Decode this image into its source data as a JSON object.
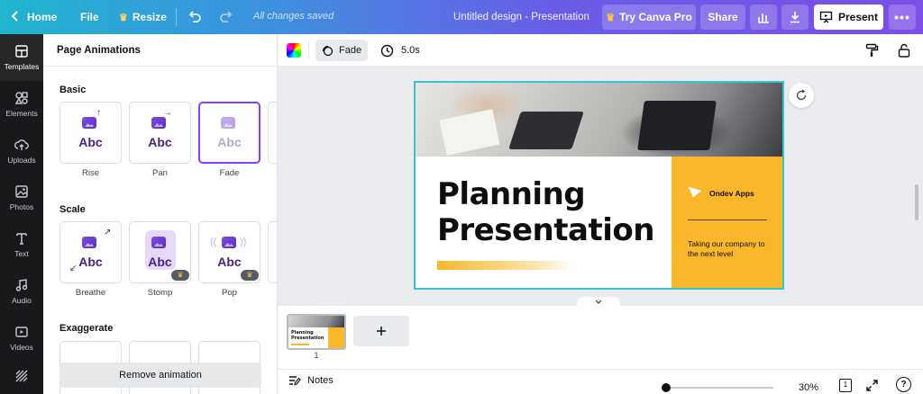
{
  "topbar": {
    "home_label": "Home",
    "file_label": "File",
    "resize_label": "Resize",
    "saved_status": "All changes saved",
    "doc_title": "Untitled design - Presentation",
    "pro_label": "Try Canva Pro",
    "share_label": "Share",
    "present_label": "Present"
  },
  "rail": {
    "items": [
      {
        "label": "Templates",
        "icon": "templates-icon"
      },
      {
        "label": "Elements",
        "icon": "elements-icon"
      },
      {
        "label": "Uploads",
        "icon": "uploads-icon"
      },
      {
        "label": "Photos",
        "icon": "photos-icon"
      },
      {
        "label": "Text",
        "icon": "text-icon"
      },
      {
        "label": "Audio",
        "icon": "audio-icon"
      },
      {
        "label": "Videos",
        "icon": "videos-icon"
      }
    ]
  },
  "panel": {
    "title": "Page Animations",
    "sections": {
      "basic": {
        "label": "Basic",
        "cards": [
          {
            "label": "Rise",
            "abc": "Abc"
          },
          {
            "label": "Pan",
            "abc": "Abc"
          },
          {
            "label": "Fade",
            "abc": "Abc",
            "selected": true
          }
        ]
      },
      "scale": {
        "label": "Scale",
        "cards": [
          {
            "label": "Breathe",
            "abc": "Abc"
          },
          {
            "label": "Stomp",
            "abc": "Abc",
            "pro": true
          },
          {
            "label": "Pop",
            "abc": "Abc",
            "pro": true
          }
        ]
      },
      "exaggerate": {
        "label": "Exaggerate"
      }
    },
    "remove_label": "Remove animation"
  },
  "toolbar": {
    "animation_label": "Fade",
    "duration": "5.0s"
  },
  "slide": {
    "title_line1": "Planning",
    "title_line2": "Presentation",
    "brand": "Ondev Apps",
    "tagline": "Taking our company to the next level",
    "accent_color": "#fbb72b",
    "border_color": "#35c4d0"
  },
  "pages": {
    "thumb_title_line1": "Planning",
    "thumb_title_line2": "Presentation",
    "page_number": "1"
  },
  "bottombar": {
    "notes_label": "Notes",
    "zoom": "30%",
    "page_count": "1"
  }
}
